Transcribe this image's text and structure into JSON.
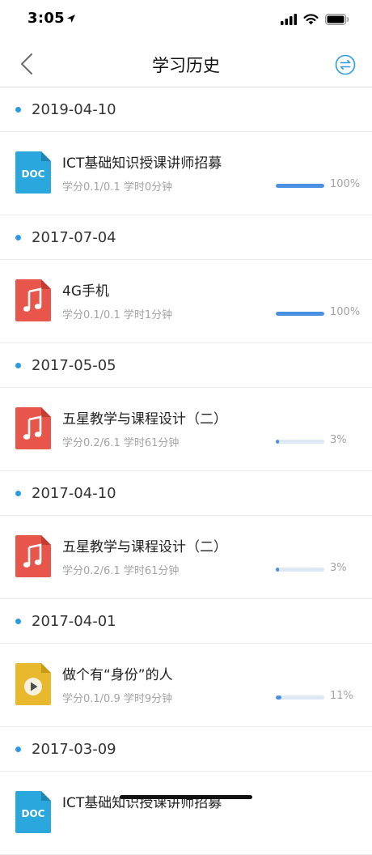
{
  "status": {
    "time": "3:05"
  },
  "nav": {
    "title": "学习历史"
  },
  "groups": [
    {
      "date": "2019-04-10",
      "item": {
        "kind": "doc",
        "icon_label": "DOC",
        "title": "ICT基础知识授课讲师招募",
        "meta": "学分0.1/0.1 学时0分钟",
        "progress": 1.0,
        "progress_label": "100%"
      }
    },
    {
      "date": "2017-07-04",
      "item": {
        "kind": "audio",
        "title": "4G手机",
        "meta": "学分0.1/0.1 学时1分钟",
        "progress": 1.0,
        "progress_label": "100%"
      }
    },
    {
      "date": "2017-05-05",
      "item": {
        "kind": "audio",
        "title": "五星教学与课程设计（二）",
        "meta": "学分0.2/6.1 学时61分钟",
        "progress": 0.03,
        "progress_label": "3%"
      }
    },
    {
      "date": "2017-04-10",
      "item": {
        "kind": "audio",
        "title": "五星教学与课程设计（二）",
        "meta": "学分0.2/6.1 学时61分钟",
        "progress": 0.03,
        "progress_label": "3%"
      }
    },
    {
      "date": "2017-04-01",
      "item": {
        "kind": "video",
        "title": "做个有“身份”的人",
        "meta": "学分0.1/0.9 学时9分钟",
        "progress": 0.11,
        "progress_label": "11%"
      }
    },
    {
      "date": "2017-03-09",
      "item": {
        "kind": "doc",
        "icon_label": "DOC",
        "title": "ICT基础知识授课讲师招募",
        "meta": "",
        "progress": null,
        "progress_label": ""
      }
    }
  ],
  "colors": {
    "accent": "#2b9be6",
    "doc": "#2aa7dc",
    "audio": "#e8564b",
    "video": "#e8b92c",
    "progress": "#4a90e2"
  },
  "icons": {
    "back": "chevron-left-icon",
    "switch": "swap-arrows-icon",
    "doc": "doc-file-icon",
    "audio": "music-note-icon",
    "video": "play-icon"
  }
}
